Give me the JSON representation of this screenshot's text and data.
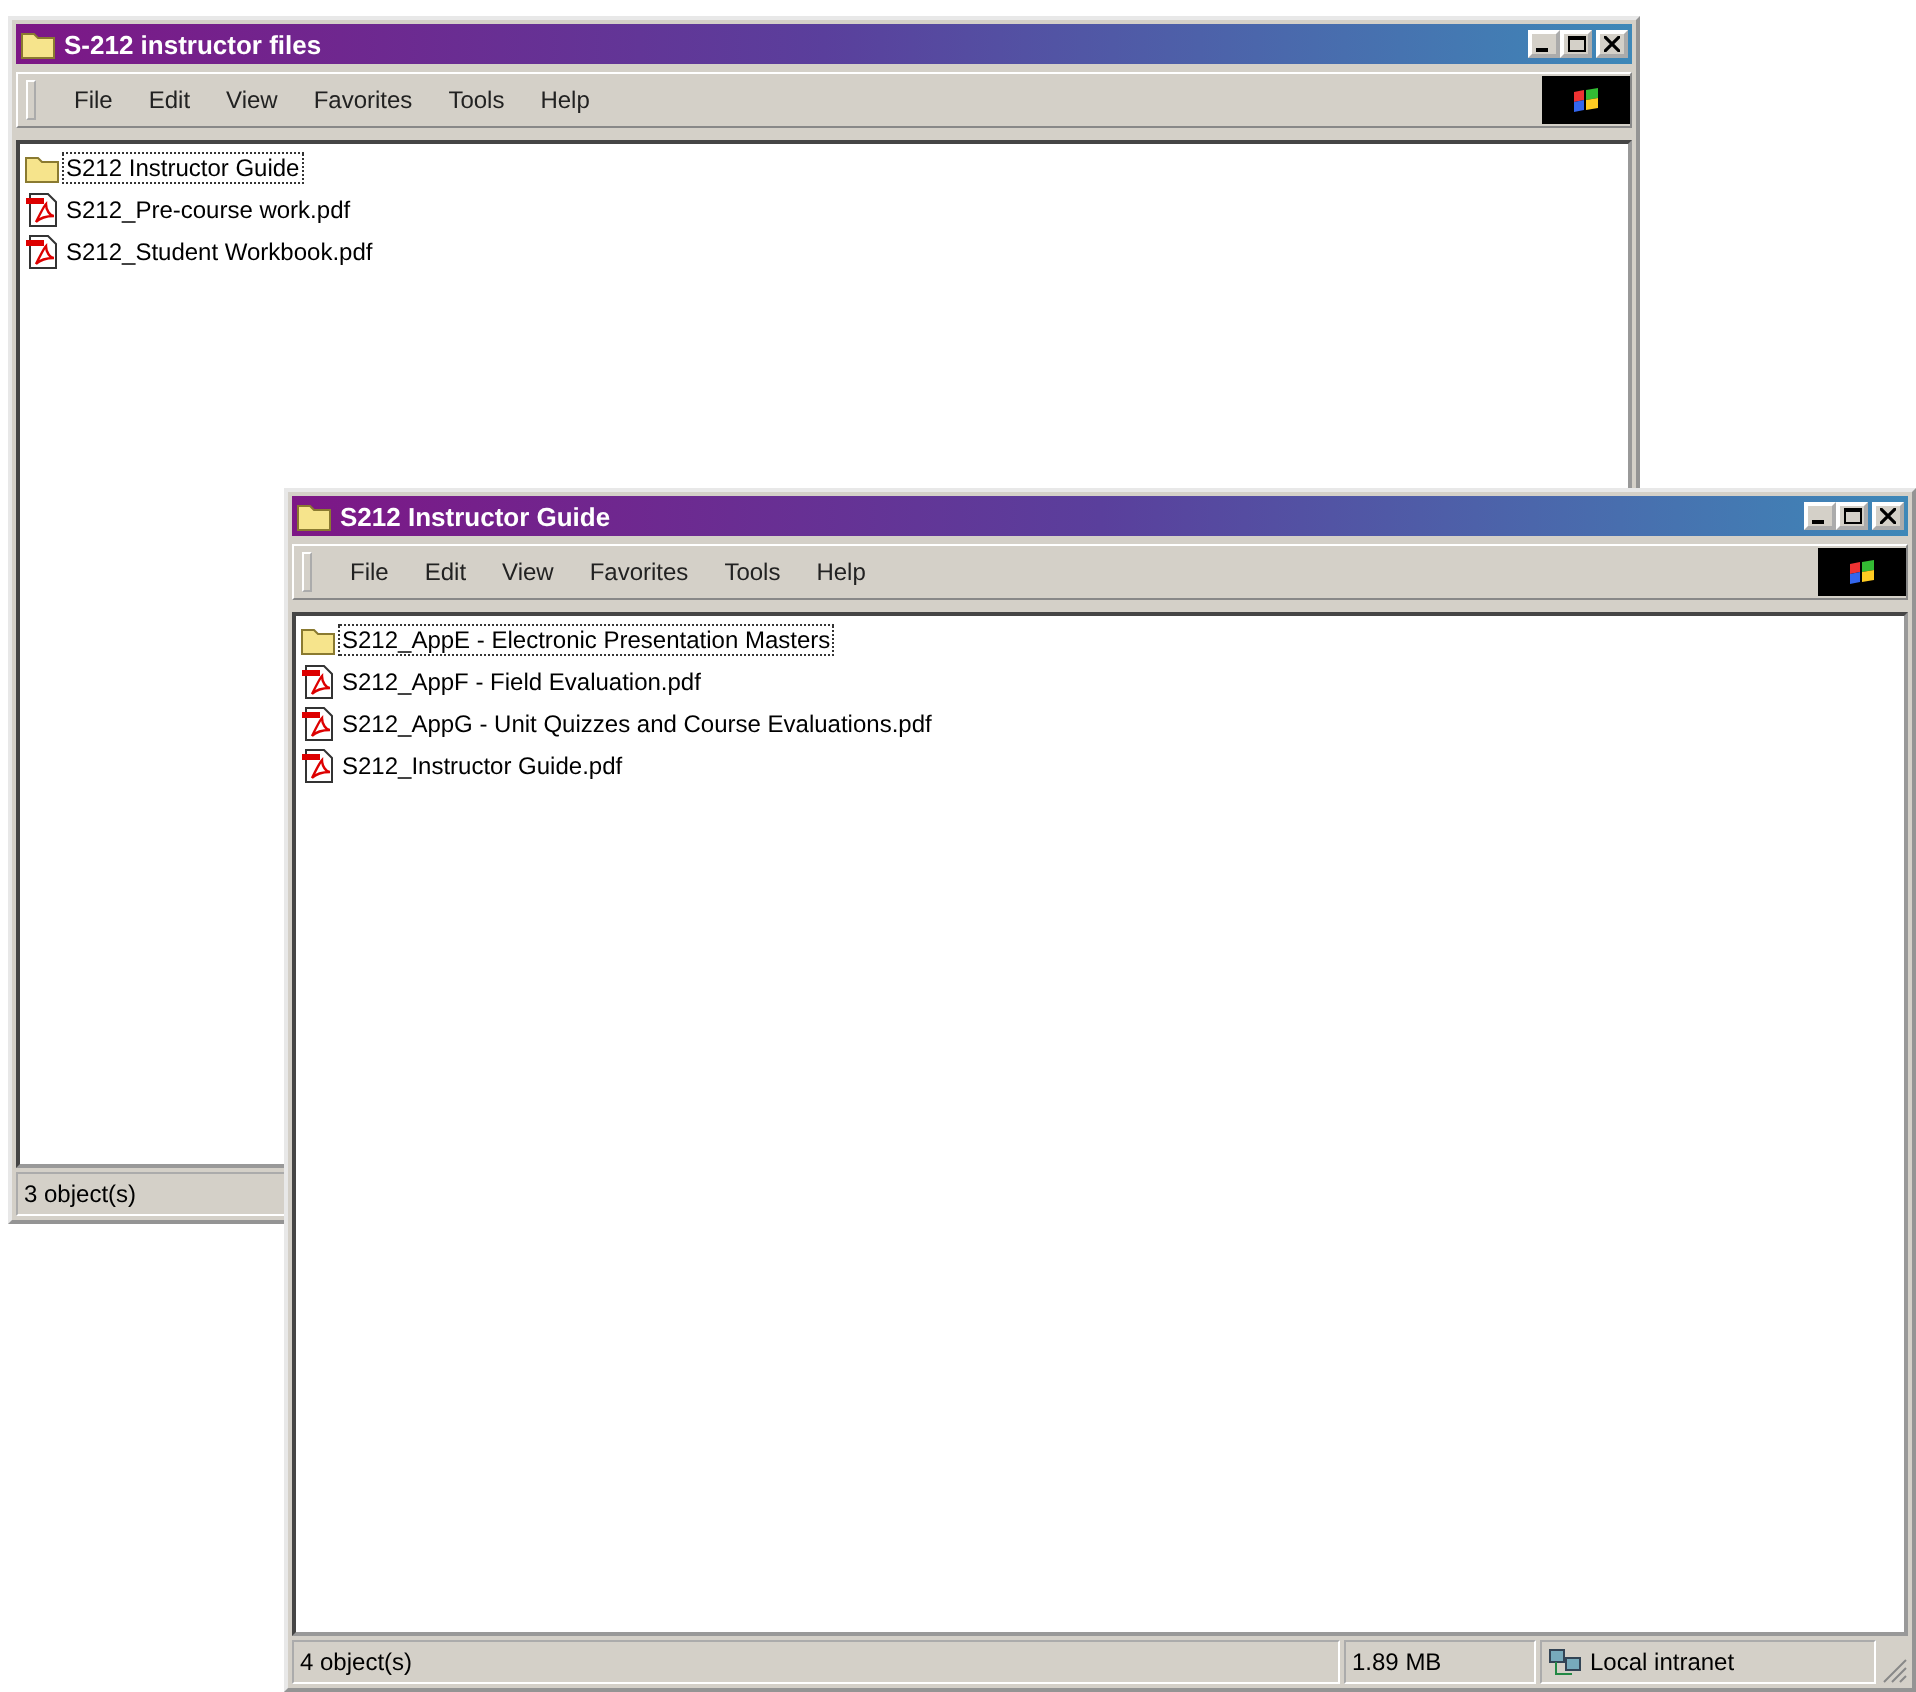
{
  "windows": [
    {
      "title": "S-212 instructor files",
      "menu": [
        "File",
        "Edit",
        "View",
        "Favorites",
        "Tools",
        "Help"
      ],
      "items": [
        {
          "kind": "folder",
          "name": "S212 Instructor Guide",
          "selected": true
        },
        {
          "kind": "pdf",
          "name": "S212_Pre-course work.pdf",
          "selected": false
        },
        {
          "kind": "pdf",
          "name": "S212_Student Workbook.pdf",
          "selected": false
        }
      ],
      "status_bar": {
        "objects": "3 object(s)"
      }
    },
    {
      "title": "S212 Instructor Guide",
      "menu": [
        "File",
        "Edit",
        "View",
        "Favorites",
        "Tools",
        "Help"
      ],
      "items": [
        {
          "kind": "folder",
          "name": "S212_AppE - Electronic Presentation Masters",
          "selected": true
        },
        {
          "kind": "pdf",
          "name": "S212_AppF - Field Evaluation.pdf",
          "selected": false
        },
        {
          "kind": "pdf",
          "name": "S212_AppG - Unit Quizzes and Course Evaluations.pdf",
          "selected": false
        },
        {
          "kind": "pdf",
          "name": "S212_Instructor Guide.pdf",
          "selected": false
        }
      ],
      "status_bar": {
        "objects": "4 object(s)",
        "size": "1.89 MB",
        "zone": "Local intranet"
      }
    }
  ]
}
